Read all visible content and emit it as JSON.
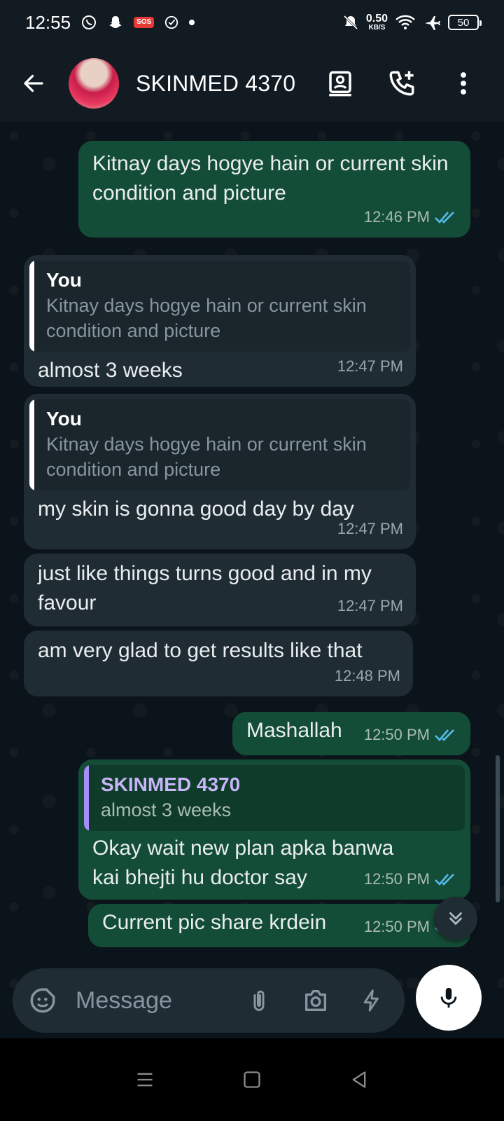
{
  "status_bar": {
    "time": "12:55",
    "sos_label": "SOS",
    "net_speed_value": "0.50",
    "net_speed_unit": "KB/S",
    "battery_level": "50"
  },
  "header": {
    "contact_name": "SKINMED 4370"
  },
  "messages": [
    {
      "direction": "out",
      "text": "Kitnay days hogye hain or current skin condition and picture",
      "time": "12:46 PM",
      "status": "read"
    },
    {
      "direction": "in",
      "quote_author": "You",
      "quote_text": "Kitnay days hogye hain or current skin condition and picture",
      "text": "almost 3 weeks",
      "time": "12:47 PM"
    },
    {
      "direction": "in",
      "quote_author": "You",
      "quote_text": "Kitnay days hogye hain or current skin condition and picture",
      "text": "my skin is gonna good day by day",
      "time": "12:47 PM"
    },
    {
      "direction": "in",
      "text": "just like things turns good and in my favour",
      "time": "12:47 PM"
    },
    {
      "direction": "in",
      "text": "am very glad to get results like that",
      "time": "12:48 PM"
    },
    {
      "direction": "out",
      "text": "Mashallah",
      "time": "12:50 PM",
      "status": "read"
    },
    {
      "direction": "out",
      "quote_author": "SKINMED 4370",
      "quote_text": "almost 3 weeks",
      "text": "Okay wait new plan apka banwa kai bhejti hu doctor say",
      "time": "12:50 PM",
      "status": "read"
    },
    {
      "direction": "out",
      "text": "Current pic share krdein",
      "time": "12:50 PM",
      "status": "read"
    }
  ],
  "composer": {
    "placeholder": "Message"
  },
  "colors": {
    "outgoing_bubble": "#144d37",
    "incoming_bubble": "#1f2c34",
    "read_tick": "#53bdeb",
    "background": "#0b141a"
  },
  "icons": [
    "back-arrow-icon",
    "contact-card-icon",
    "add-call-icon",
    "more-vert-icon",
    "emoji-sticker-icon",
    "attach-icon",
    "camera-icon",
    "bolt-icon",
    "mic-icon",
    "double-chevron-down-icon"
  ]
}
